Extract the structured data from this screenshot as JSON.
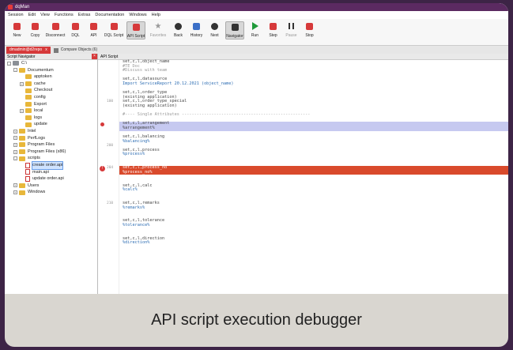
{
  "app": {
    "title": "dqMan"
  },
  "menu": [
    "Session",
    "Edit",
    "View",
    "Functions",
    "Extras",
    "Documentation",
    "Windows",
    "Help"
  ],
  "toolbar": [
    {
      "label": "New",
      "icon": "new-icon",
      "color": "#d6393a"
    },
    {
      "label": "Copy",
      "icon": "copy-icon",
      "color": "#d6393a"
    },
    {
      "label": "Disconnect",
      "icon": "disconnect-icon",
      "color": "#d6393a"
    },
    {
      "label": "DQL",
      "icon": "dql-icon",
      "color": "#d6393a"
    },
    {
      "label": "API",
      "icon": "api-icon",
      "color": "#d6393a"
    },
    {
      "label": "DQL Script",
      "icon": "dql-script-icon",
      "color": "#d6393a"
    },
    {
      "label": "API Script",
      "icon": "api-script-icon",
      "color": "#d6393a"
    },
    {
      "label": "Favorites",
      "icon": "star-icon",
      "color": "#999999"
    },
    {
      "label": "Back",
      "icon": "back-icon",
      "color": "#333333"
    },
    {
      "label": "History",
      "icon": "history-icon",
      "color": "#3b6fc7"
    },
    {
      "label": "Next",
      "icon": "next-icon",
      "color": "#333333"
    },
    {
      "label": "Navigator",
      "icon": "navigator-icon",
      "color": "#333333"
    },
    {
      "label": "Run",
      "icon": "run-icon",
      "color": "#1f9a3a"
    },
    {
      "label": "Step",
      "icon": "step-icon",
      "color": "#d6393a"
    },
    {
      "label": "Pause",
      "icon": "pause-icon",
      "color": "#333333"
    },
    {
      "label": "Stop",
      "icon": "stop-icon",
      "color": "#d6393a"
    }
  ],
  "tabs": [
    {
      "label": "dmadmin@d2repo",
      "close": "x"
    },
    {
      "label": "Compare Objects (6)",
      "close": "x"
    }
  ],
  "navigator": {
    "title": "Script Navigator",
    "items": [
      {
        "label": "C:\\",
        "level": 0,
        "type": "drive",
        "exp": "-"
      },
      {
        "label": "Documentum",
        "level": 1,
        "type": "folder",
        "exp": "-"
      },
      {
        "label": "apptoken",
        "level": 2,
        "type": "folder",
        "exp": ""
      },
      {
        "label": "cache",
        "level": 2,
        "type": "folder",
        "exp": "+"
      },
      {
        "label": "Checkout",
        "level": 2,
        "type": "folder",
        "exp": ""
      },
      {
        "label": "config",
        "level": 2,
        "type": "folder",
        "exp": ""
      },
      {
        "label": "Export",
        "level": 2,
        "type": "folder",
        "exp": ""
      },
      {
        "label": "local",
        "level": 2,
        "type": "folder",
        "exp": "+"
      },
      {
        "label": "logs",
        "level": 2,
        "type": "folder",
        "exp": ""
      },
      {
        "label": "update",
        "level": 2,
        "type": "folder",
        "exp": ""
      },
      {
        "label": "Intel",
        "level": 1,
        "type": "folder",
        "exp": "+"
      },
      {
        "label": "PerfLogs",
        "level": 1,
        "type": "folder",
        "exp": "+"
      },
      {
        "label": "Program Files",
        "level": 1,
        "type": "folder",
        "exp": "+"
      },
      {
        "label": "Program Files (x86)",
        "level": 1,
        "type": "folder",
        "exp": "+"
      },
      {
        "label": "scripts",
        "level": 1,
        "type": "folder",
        "exp": "-"
      },
      {
        "label": "create order.api",
        "level": 2,
        "type": "file",
        "exp": "",
        "selected": true
      },
      {
        "label": "main.api",
        "level": 2,
        "type": "file",
        "exp": ""
      },
      {
        "label": "update order.api",
        "level": 2,
        "type": "file",
        "exp": ""
      },
      {
        "label": "Users",
        "level": 1,
        "type": "folder",
        "exp": "+"
      },
      {
        "label": "Windows",
        "level": 1,
        "type": "folder",
        "exp": "+"
      }
    ]
  },
  "editor": {
    "title": "API Script",
    "lines": [
      {
        "text": "set,c,l,object_name",
        "style": ""
      },
      {
        "text": "#TE Doc",
        "style": "cm"
      },
      {
        "text": "#Discuss with team",
        "style": "cm"
      },
      {
        "text": "",
        "style": ""
      },
      {
        "text": "set,c,l,datasource",
        "style": ""
      },
      {
        "text": "Import ServiceReport 20.12.2021 (object_name)",
        "style": "blue"
      },
      {
        "text": "",
        "style": ""
      },
      {
        "text": "set,c,l,order_type",
        "style": ""
      },
      {
        "text": "(existing application)",
        "style": ""
      },
      {
        "text": "set,c,l,order_type_special",
        "style": "",
        "num": "100"
      },
      {
        "text": "(existing application)",
        "style": ""
      },
      {
        "text": "",
        "style": ""
      },
      {
        "text": "#---- Single Attributes ----------------------------------------------------",
        "style": "cm"
      },
      {
        "text": "",
        "style": ""
      },
      {
        "text": "set,c,l,arrangement",
        "style": "hl",
        "bp": "small"
      },
      {
        "text": "%arrangement%",
        "style": "hl"
      },
      {
        "text": "",
        "style": ""
      },
      {
        "text": "set,c,l,balancing",
        "style": ""
      },
      {
        "text": "%balancing%",
        "style": "blue"
      },
      {
        "text": "",
        "style": "",
        "num": "200"
      },
      {
        "text": "set,c,l,process",
        "style": ""
      },
      {
        "text": "%process%",
        "style": "blue"
      },
      {
        "text": "",
        "style": ""
      },
      {
        "text": "",
        "style": ""
      },
      {
        "text": "set,c,l,process_no",
        "style": "err",
        "bp": "big",
        "num": "204"
      },
      {
        "text": "%process_no%",
        "style": "err"
      },
      {
        "text": "",
        "style": ""
      },
      {
        "text": "",
        "style": ""
      },
      {
        "text": "set,c,l,calc",
        "style": ""
      },
      {
        "text": "%calc%",
        "style": "blue"
      },
      {
        "text": "",
        "style": ""
      },
      {
        "text": "",
        "style": ""
      },
      {
        "text": "set,c,l,remarks",
        "style": "",
        "num": "210"
      },
      {
        "text": "%remarks%",
        "style": "blue"
      },
      {
        "text": "",
        "style": ""
      },
      {
        "text": "",
        "style": ""
      },
      {
        "text": "set,c,l,tolerance",
        "style": ""
      },
      {
        "text": "%tolerance%",
        "style": "blue"
      },
      {
        "text": "",
        "style": ""
      },
      {
        "text": "",
        "style": ""
      },
      {
        "text": "set,c,l,direction",
        "style": ""
      },
      {
        "text": "%direction%",
        "style": "blue"
      }
    ]
  },
  "caption": "API script execution debugger"
}
